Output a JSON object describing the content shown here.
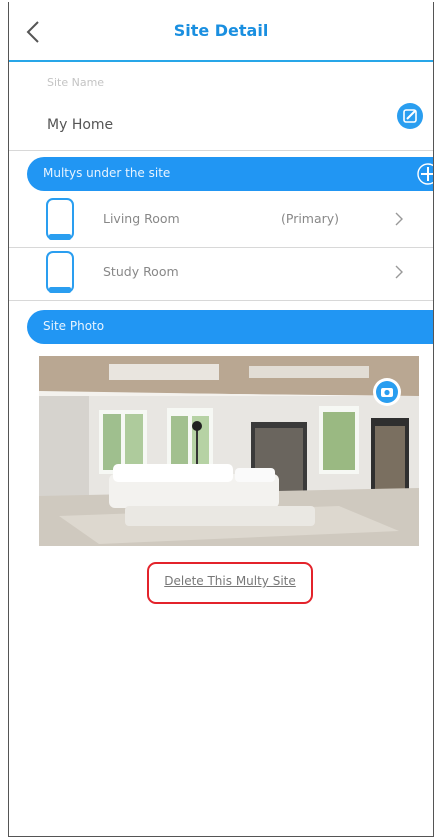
{
  "header": {
    "title": "Site Detail"
  },
  "site_name": {
    "label": "Site Name",
    "value": "My Home"
  },
  "multys_section": {
    "label": "Multys under the site",
    "devices": [
      {
        "name": "Living Room",
        "role": "(Primary)"
      },
      {
        "name": "Study Room",
        "role": ""
      }
    ]
  },
  "photo_section": {
    "label": "Site Photo"
  },
  "actions": {
    "delete_label": "Delete This Multy Site"
  },
  "colors": {
    "accent": "#2196f3",
    "title": "#1a8fe0",
    "highlight": "#e3232b"
  }
}
